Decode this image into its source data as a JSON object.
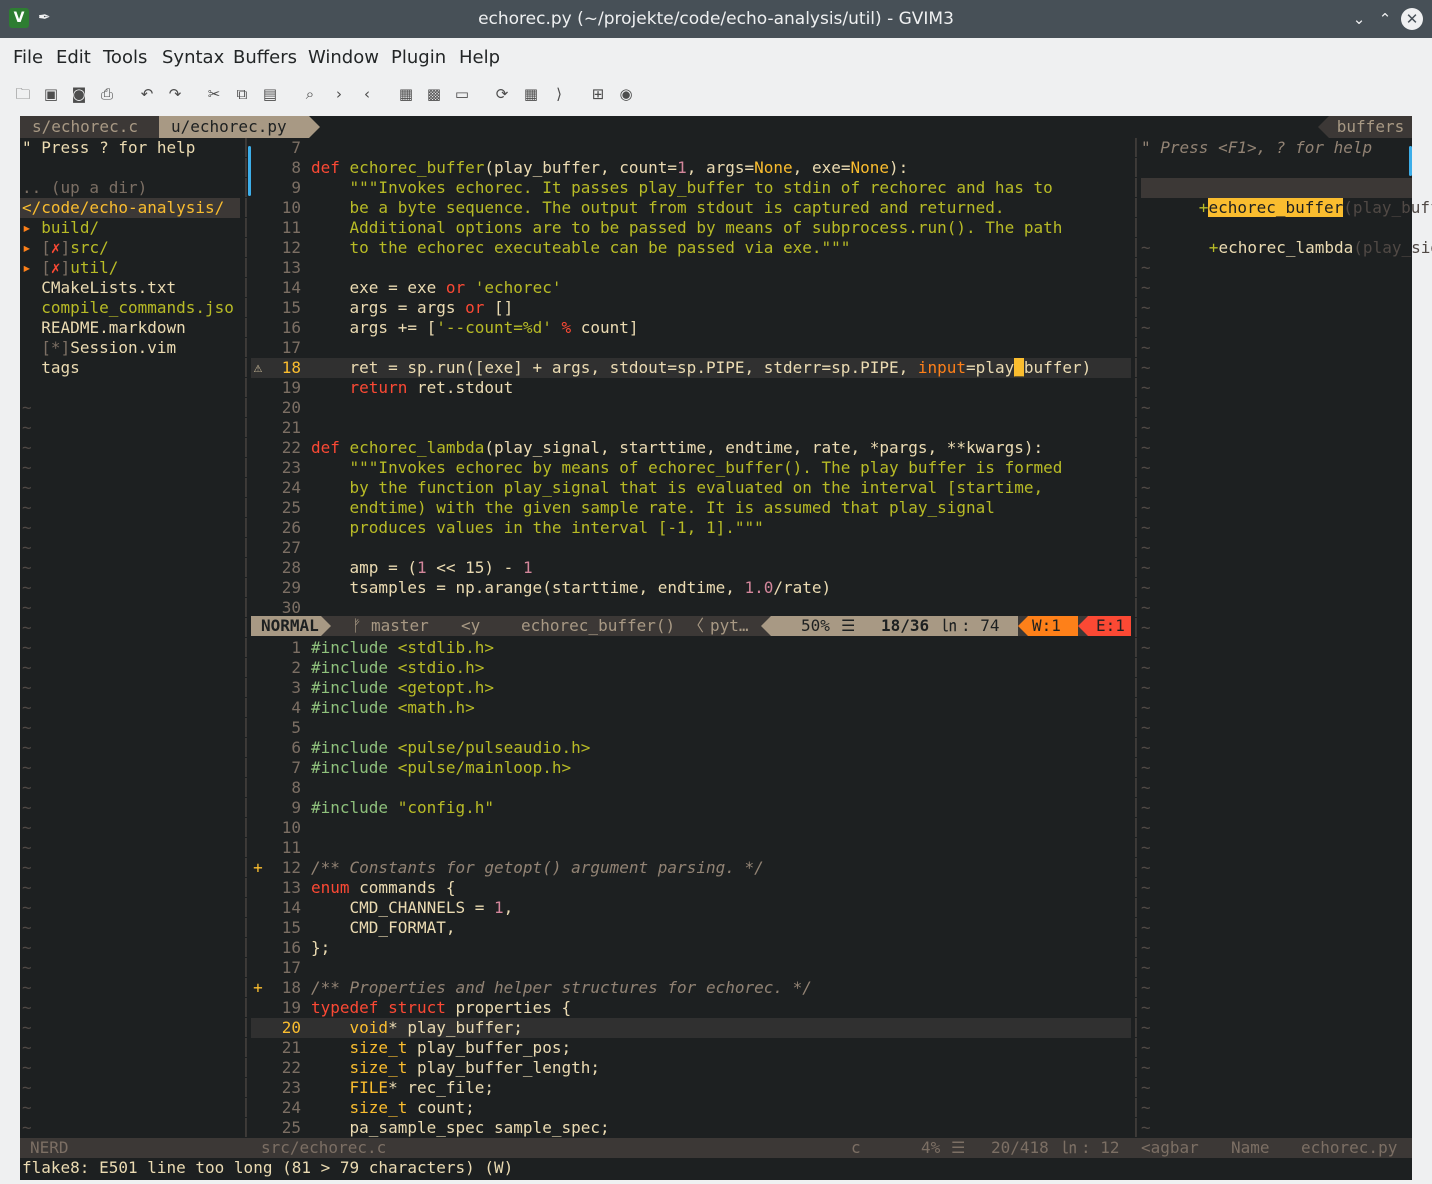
{
  "window": {
    "title": "echorec.py (~/projekte/code/echo-analysis/util) - GVIM3"
  },
  "menu": [
    "File",
    "Edit",
    "Tools",
    "Syntax",
    "Buffers",
    "Window",
    "Plugin",
    "Help"
  ],
  "toolbar": {
    "icons": [
      "open-icon",
      "save-icon",
      "save-all-icon",
      "print-icon",
      "undo-icon",
      "redo-icon",
      "cut-icon",
      "copy-icon",
      "paste-icon",
      "find-icon",
      "find-next-icon",
      "find-prev-icon",
      "load-session-icon",
      "save-session-icon",
      "run-script-icon",
      "make-icon",
      "tags-icon",
      "jump-tag-icon",
      "help-icon",
      "find-help-icon"
    ]
  },
  "tabline": {
    "tabs": [
      "s/echorec.c",
      "u/echorec.py"
    ],
    "right_label": "buffers"
  },
  "nerdtree": {
    "help": "\" Press ? for help",
    "up": ".. (up a dir)",
    "root": "</code/echo-analysis/",
    "entries": [
      {
        "arrow": "▸",
        "mark": "",
        "name": "build/"
      },
      {
        "arrow": "▸",
        "mark": "✗",
        "name": "src/"
      },
      {
        "arrow": "▸",
        "mark": "✗",
        "name": "util/"
      },
      {
        "arrow": "",
        "mark": "",
        "name": "CMakeLists.txt"
      },
      {
        "arrow": "",
        "mark": "",
        "name": "compile_commands.jso"
      },
      {
        "arrow": "",
        "mark": "",
        "name": "README.markdown"
      },
      {
        "arrow": "",
        "mark": "*",
        "name": "Session.vim"
      },
      {
        "arrow": "",
        "mark": "",
        "name": "tags"
      }
    ]
  },
  "tagbar": {
    "help": "\" Press <F1>, ? for help",
    "items": [
      {
        "name": "echorec_buffer",
        "args": "(play_buffe"
      },
      {
        "name": "echorec_lambda",
        "args": "(play_signa"
      }
    ]
  },
  "python_pane": {
    "current_line": "18",
    "lines": [
      {
        "n": "7",
        "c": ""
      },
      {
        "n": "8",
        "c": "def echorec_buffer(play_buffer, count=1, args=None, exe=None):"
      },
      {
        "n": "9",
        "c": "    \"\"\"Invokes echorec. It passes play_buffer to stdin of rechorec and has to"
      },
      {
        "n": "10",
        "c": "    be a byte sequence. The output from stdout is captured and returned."
      },
      {
        "n": "11",
        "c": "    Additional options are to be passed by means of subprocess.run(). The path"
      },
      {
        "n": "12",
        "c": "    to the echorec executeable can be passed via exe.\"\"\""
      },
      {
        "n": "13",
        "c": ""
      },
      {
        "n": "14",
        "c": "    exe = exe or 'echorec'"
      },
      {
        "n": "15",
        "c": "    args = args or []"
      },
      {
        "n": "16",
        "c": "    args += ['--count=%d' % count]"
      },
      {
        "n": "17",
        "c": ""
      },
      {
        "n": "18",
        "c": "    ret = sp.run([exe] + args, stdout=sp.PIPE, stderr=sp.PIPE, input=play_buffer)"
      },
      {
        "n": "19",
        "c": "    return ret.stdout"
      },
      {
        "n": "20",
        "c": ""
      },
      {
        "n": "21",
        "c": ""
      },
      {
        "n": "22",
        "c": "def echorec_lambda(play_signal, starttime, endtime, rate, *pargs, **kwargs):"
      },
      {
        "n": "23",
        "c": "    \"\"\"Invokes echorec by means of echorec_buffer(). The play buffer is formed"
      },
      {
        "n": "24",
        "c": "    by the function play_signal that is evaluated on the interval [startime,"
      },
      {
        "n": "25",
        "c": "    endtime) with the given sample rate. It is assumed that play_signal"
      },
      {
        "n": "26",
        "c": "    produces values in the interval [-1, 1].\"\"\""
      },
      {
        "n": "27",
        "c": ""
      },
      {
        "n": "28",
        "c": "    amp = (1 << 15) - 1"
      },
      {
        "n": "29",
        "c": "    tsamples = np.arange(starttime, endtime, 1.0/rate)"
      },
      {
        "n": "30",
        "c": ""
      }
    ]
  },
  "python_status": {
    "mode": "NORMAL",
    "branch_icon": "ᚠ",
    "branch": "master",
    "tagbar_ref": "<y",
    "function": "echorec_buffer()",
    "filetype": "pyt…",
    "percent": "50%",
    "position": "18/36",
    "ln_icon": "㏑",
    "column": ": 74",
    "warnings": "W:1",
    "errors": "E:1"
  },
  "c_pane": {
    "current_line": "20",
    "lines": [
      {
        "n": "1",
        "c": "#include <stdlib.h>"
      },
      {
        "n": "2",
        "c": "#include <stdio.h>"
      },
      {
        "n": "3",
        "c": "#include <getopt.h>"
      },
      {
        "n": "4",
        "c": "#include <math.h>"
      },
      {
        "n": "5",
        "c": ""
      },
      {
        "n": "6",
        "c": "#include <pulse/pulseaudio.h>"
      },
      {
        "n": "7",
        "c": "#include <pulse/mainloop.h>"
      },
      {
        "n": "8",
        "c": ""
      },
      {
        "n": "9",
        "c": "#include \"config.h\""
      },
      {
        "n": "10",
        "c": ""
      },
      {
        "n": "11",
        "c": ""
      },
      {
        "n": "12",
        "c": "/** Constants for getopt() argument parsing. */"
      },
      {
        "n": "13",
        "c": "enum commands {"
      },
      {
        "n": "14",
        "c": "    CMD_CHANNELS = 1,"
      },
      {
        "n": "15",
        "c": "    CMD_FORMAT,"
      },
      {
        "n": "16",
        "c": "};"
      },
      {
        "n": "17",
        "c": ""
      },
      {
        "n": "18",
        "c": "/** Properties and helper structures for echorec. */"
      },
      {
        "n": "19",
        "c": "typedef struct properties {"
      },
      {
        "n": "20",
        "c": "    void* play_buffer;"
      },
      {
        "n": "21",
        "c": "    size_t play_buffer_pos;"
      },
      {
        "n": "22",
        "c": "    size_t play_buffer_length;"
      },
      {
        "n": "23",
        "c": "    FILE* rec_file;"
      },
      {
        "n": "24",
        "c": "    size_t count;"
      },
      {
        "n": "25",
        "c": "    pa_sample_spec sample_spec;"
      }
    ]
  },
  "bottom_status": {
    "nerd": "NERD",
    "file": "src/echorec.c",
    "filetype": "c",
    "percent": "4%",
    "position": "20/418",
    "ln_icon": "㏑",
    "column": ": 12",
    "tagbar": "<agbar",
    "sort": "Name",
    "tag_file": "echorec.py"
  },
  "message": "flake8: E501 line too long (81 > 79 characters) (W)",
  "colors": {
    "background": "#1d2021",
    "foreground": "#ebdbb2",
    "keyword": "#fb4934",
    "function": "#b8bb26",
    "number": "#d3869b",
    "accent": "#fabd2f",
    "warning": "#fe8019",
    "error": "#fb4934",
    "comment": "#928374"
  }
}
